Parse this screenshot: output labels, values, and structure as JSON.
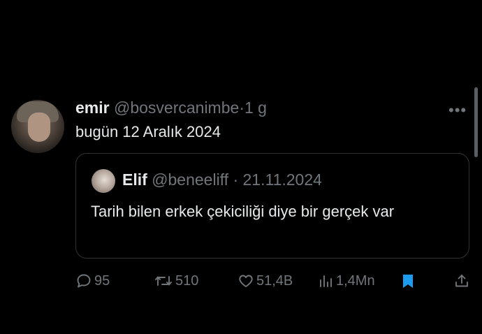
{
  "tweet": {
    "author_name": "emir",
    "author_handle": "@bosvercanimbe",
    "separator": "·",
    "time": "1 g",
    "text": "bugün 12 Aralık 2024",
    "more_icon": "more-icon"
  },
  "quote": {
    "author_name": "Elif",
    "author_handle": "@beneeliff",
    "separator": "·",
    "date": "21.11.2024",
    "text": "Tarih bilen erkek çekiciliği diye bir gerçek var"
  },
  "actions": {
    "replies": "95",
    "retweets": "510",
    "likes": "51,4B",
    "views": "1,4Mn",
    "bookmark_color": "#1d9bf0"
  },
  "colors": {
    "background": "#000000",
    "text_primary": "#e7e9ea",
    "text_secondary": "#71767b",
    "border": "#2f3336",
    "accent": "#1d9bf0"
  }
}
